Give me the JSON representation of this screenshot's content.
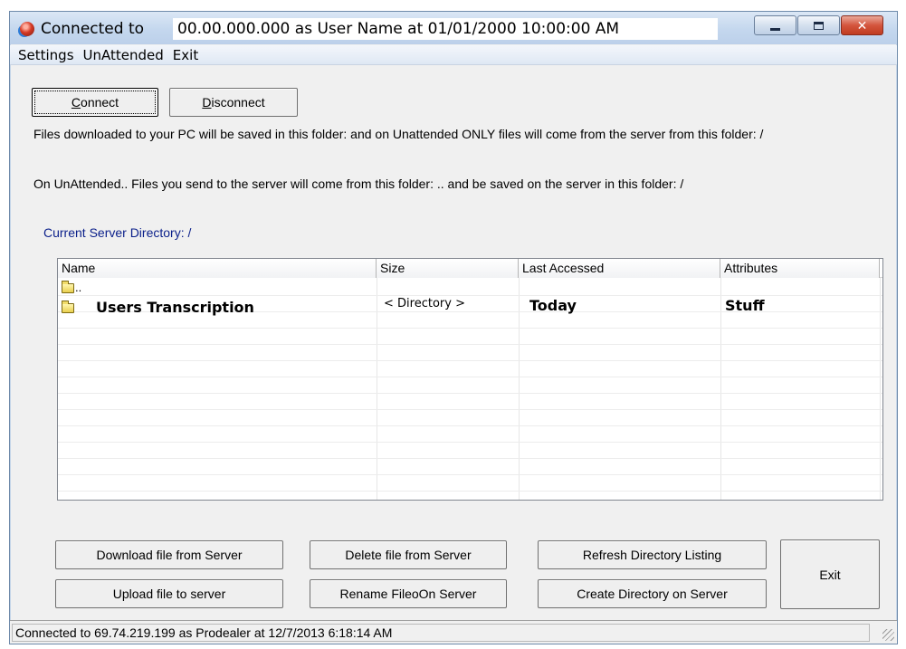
{
  "window": {
    "title_prefix": "Connected to",
    "title_highlight": "00.00.000.000 as User Name at 01/01/2000 10:00:00  AM",
    "close_glyph": "✕"
  },
  "menu": {
    "items": [
      "Settings",
      "UnAttended",
      "Exit"
    ]
  },
  "connection": {
    "connect_label": "Connect",
    "connect_accel": "C",
    "connect_rest": "onnect",
    "disconnect_accel": "D",
    "disconnect_rest": "isconnect"
  },
  "info": {
    "download_folder_text": "Files downloaded to your PC will be saved in this folder:  and on Unattended ONLY files will come from the server from this folder: /",
    "upload_folder_text": "On UnAttended.. Files you send to the server will come from this folder: .. and be saved on the server in this folder: /",
    "current_dir_text": "Current Server Directory: /"
  },
  "file_list": {
    "columns": [
      "Name",
      "Size",
      "Last Accessed",
      "Attributes"
    ],
    "rows": [
      {
        "name": "..",
        "size": "",
        "accessed": "",
        "attributes": ""
      },
      {
        "name": "Users Transcription",
        "size": "< Directory >",
        "accessed": "Today",
        "attributes": "Stuff"
      }
    ]
  },
  "actions": {
    "download": "Download file from Server",
    "upload": "Upload file to server",
    "delete": "Delete file from Server",
    "rename": "Rename FileoOn Server",
    "refresh": "Refresh Directory Listing",
    "create_dir": "Create Directory on Server",
    "exit": "Exit"
  },
  "status": {
    "text": "Connected to 69.74.219.199 as Prodealer at 12/7/2013 6:18:14 AM"
  },
  "colors": {
    "info_blue": "#0a1f8a",
    "window_bg": "#f0f0f0",
    "close_red": "#c03c20"
  }
}
